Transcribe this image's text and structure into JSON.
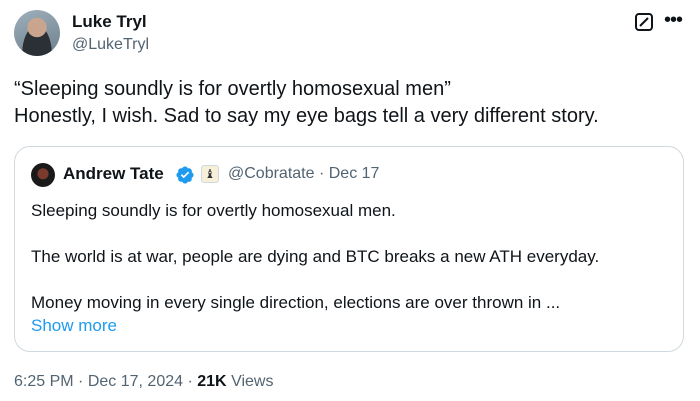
{
  "author": {
    "name": "Luke Tryl",
    "handle": "@LukeTryl"
  },
  "tweet": {
    "lines": [
      "“Sleeping soundly is for overtly homosexual men”",
      "Honestly, I wish. Sad to say my eye bags tell a very different story."
    ],
    "time": "6:25 PM",
    "separator": "·",
    "date": "Dec 17, 2024",
    "views_count": "21K",
    "views_label": "Views"
  },
  "quoted": {
    "name": "Andrew Tate",
    "handle": "@Cobratate",
    "date": "Dec 17",
    "badge_glyph": "♝",
    "paragraphs": [
      "Sleeping soundly is for overtly homosexual men.",
      "The world is at war, people are dying and BTC breaks a new ATH everyday.",
      "Money moving in every single direction, elections are over thrown in ..."
    ],
    "show_more": "Show more"
  },
  "icons": {
    "grok": "grok-icon",
    "more": "more-icon",
    "verified": "verified-badge-icon",
    "verified_color": "#1d9bf0"
  },
  "colors": {
    "text": "#0f1419",
    "secondary": "#536471",
    "link": "#1d9bf0",
    "border": "#cfd9de"
  }
}
